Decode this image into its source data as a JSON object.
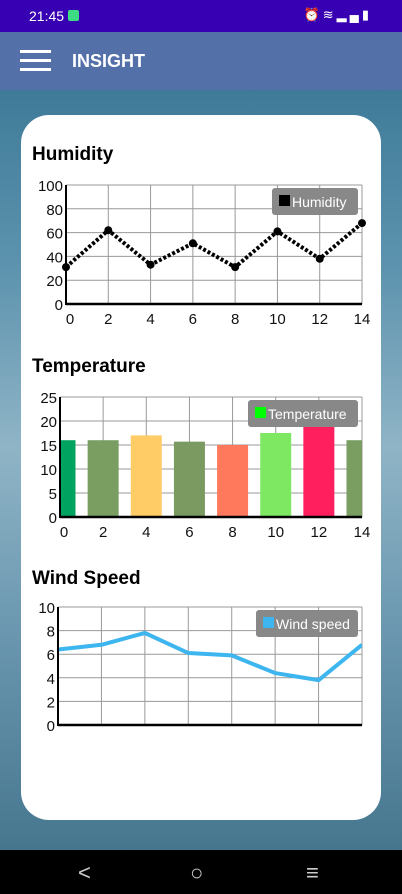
{
  "status_bar": {
    "time": "21:45",
    "icons": [
      "alarm-icon",
      "wifi-icon",
      "signal-icon",
      "battery-icon"
    ]
  },
  "header": {
    "title": "INSIGHT",
    "menu_icon": "hamburger-icon"
  },
  "colors": {
    "status_bar": "#3700b3",
    "header": "#5470a8"
  },
  "sections": [
    {
      "title": "Humidity"
    },
    {
      "title": "Temperature"
    },
    {
      "title": "Wind Speed"
    }
  ],
  "chart_data": [
    {
      "type": "line",
      "title": "Humidity",
      "style": "dotted",
      "color": "#000000",
      "legend": "Humidity",
      "legend_color": "#000000",
      "x": [
        0,
        2,
        4,
        6,
        8,
        10,
        12,
        14
      ],
      "values": [
        31,
        62,
        33,
        51,
        31,
        61,
        38,
        68
      ],
      "ylim": [
        0,
        100
      ],
      "yticks": [
        0,
        20,
        40,
        60,
        80,
        100
      ],
      "xticks": [
        0,
        2,
        4,
        6,
        8,
        10,
        12,
        14
      ],
      "grid": true,
      "legend_position": "top-right"
    },
    {
      "type": "bar",
      "title": "Temperature",
      "legend": "Temperature",
      "legend_color": "#00ff00",
      "x": [
        0,
        2,
        4,
        6,
        8,
        10,
        12,
        14
      ],
      "values": [
        16,
        16,
        17,
        15.7,
        15,
        17.5,
        19,
        16
      ],
      "bar_colors": [
        "#00a35f",
        "#7a9e62",
        "#ffcc66",
        "#7a9a62",
        "#ff7a5c",
        "#7ee862",
        "#ff1f5e",
        "#7a9e62"
      ],
      "ylim": [
        0,
        25
      ],
      "yticks": [
        0,
        5,
        10,
        15,
        20,
        25
      ],
      "xticks": [
        0,
        2,
        4,
        6,
        8,
        10,
        12,
        14
      ],
      "grid": true,
      "legend_position": "top-right"
    },
    {
      "type": "line",
      "title": "Wind Speed",
      "style": "solid",
      "color": "#3db5ee",
      "legend": "Wind speed",
      "legend_color": "#3db5ee",
      "x": [
        0,
        2,
        4,
        6,
        8,
        10,
        12,
        14
      ],
      "values": [
        6.4,
        6.8,
        7.8,
        6.1,
        5.9,
        4.4,
        3.8,
        6.8
      ],
      "ylim": [
        0,
        10
      ],
      "yticks": [
        0,
        2,
        4,
        6,
        8,
        10
      ],
      "xticks": [],
      "grid": true,
      "legend_position": "top-right"
    }
  ]
}
